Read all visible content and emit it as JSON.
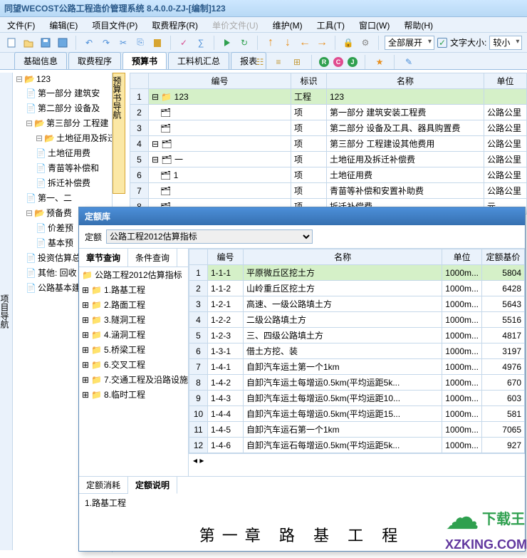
{
  "window": {
    "title": "同望WECOST公路工程造价管理系统 8.4.0.0-ZJ-[编制]123"
  },
  "menu": [
    "文件(F)",
    "编辑(E)",
    "项目文件(P)",
    "取费程序(R)",
    "单价文件(U)",
    "维护(M)",
    "工具(T)",
    "窗口(W)",
    "帮助(H)"
  ],
  "toolbar_combo1": "全部展开",
  "toolbar_label_font": "文字大小:",
  "toolbar_combo2": "较小",
  "tabs": [
    "基础信息",
    "取费程序",
    "预算书",
    "工料机汇总",
    "报表"
  ],
  "active_tab": 2,
  "side_nav_label": "项目导航",
  "inner_nav_label": "预算书导航",
  "tree": [
    {
      "lvl": 0,
      "icon": "folder-open",
      "txt": "123"
    },
    {
      "lvl": 1,
      "icon": "doc",
      "txt": "第一部分 建筑安"
    },
    {
      "lvl": 1,
      "icon": "doc",
      "txt": "第二部分 设备及"
    },
    {
      "lvl": 1,
      "icon": "folder-open",
      "txt": "第三部分 工程建"
    },
    {
      "lvl": 2,
      "icon": "folder-open",
      "txt": "土地征用及拆迁"
    },
    {
      "lvl": 2,
      "icon": "doc",
      "txt": "土地征用费"
    },
    {
      "lvl": 2,
      "icon": "doc",
      "txt": "青苗等补偿和"
    },
    {
      "lvl": 2,
      "icon": "doc",
      "txt": "拆迁补偿费"
    },
    {
      "lvl": 1,
      "icon": "doc",
      "txt": "第一、二"
    },
    {
      "lvl": 1,
      "icon": "folder-open",
      "txt": "预备费"
    },
    {
      "lvl": 2,
      "icon": "doc",
      "txt": "价差预"
    },
    {
      "lvl": 2,
      "icon": "doc",
      "txt": "基本预"
    },
    {
      "lvl": 1,
      "icon": "doc",
      "txt": "投资估算总"
    },
    {
      "lvl": 1,
      "icon": "doc",
      "txt": "其他: 回收"
    },
    {
      "lvl": 1,
      "icon": "doc",
      "txt": "公路基本建"
    }
  ],
  "grid_headers": [
    "编号",
    "标识",
    "名称",
    "单位"
  ],
  "grid_rows": [
    {
      "n": 1,
      "hl": true,
      "code": "123",
      "codeIcon": "minus",
      "mark": "工程",
      "name": "123",
      "unit": ""
    },
    {
      "n": 2,
      "code": "",
      "codeIcon": "card",
      "mark": "项",
      "name": "第一部分 建筑安装工程费",
      "unit": "公路公里"
    },
    {
      "n": 3,
      "code": "",
      "codeIcon": "card",
      "mark": "项",
      "name": "第二部分 设备及工具、器具购置费",
      "unit": "公路公里"
    },
    {
      "n": 4,
      "code": "",
      "codeIcon": "minus-card",
      "mark": "项",
      "name": "第三部分 工程建设其他费用",
      "unit": "公路公里"
    },
    {
      "n": 5,
      "code": "一",
      "codeIcon": "minus-card",
      "mark": "项",
      "name": "土地征用及拆迁补偿费",
      "unit": "公路公里"
    },
    {
      "n": 6,
      "code": "1",
      "codeIcon": "card",
      "mark": "项",
      "name": "土地征用费",
      "unit": "公路公里"
    },
    {
      "n": 7,
      "code": "",
      "codeIcon": "card",
      "mark": "项",
      "name": "青苗等补偿和安置补助费",
      "unit": "公路公里"
    },
    {
      "n": 8,
      "code": "",
      "codeIcon": "card",
      "mark": "项",
      "name": "拆迁补偿费",
      "unit": "元"
    }
  ],
  "dialog": {
    "title": "定额库",
    "label_de": "定额",
    "select_value": "公路工程2012估算指标",
    "left_tabs": [
      "章节查询",
      "条件查询"
    ],
    "tree": [
      {
        "txt": "公路工程2012估算指标"
      },
      {
        "txt": "1.路基工程",
        "exp": true
      },
      {
        "txt": "2.路面工程",
        "exp": true
      },
      {
        "txt": "3.隧洞工程",
        "exp": true
      },
      {
        "txt": "4.涵洞工程",
        "exp": true
      },
      {
        "txt": "5.桥梁工程",
        "exp": true
      },
      {
        "txt": "6.交叉工程",
        "exp": true
      },
      {
        "txt": "7.交通工程及沿路设施",
        "exp": true
      },
      {
        "txt": "8.临时工程",
        "exp": true
      }
    ],
    "grid_headers": [
      "编号",
      "名称",
      "单位",
      "定额基价"
    ],
    "rows": [
      {
        "n": 1,
        "sel": true,
        "code": "1-1-1",
        "name": "平原微丘区挖土方",
        "unit": "1000m...",
        "price": 5804
      },
      {
        "n": 2,
        "code": "1-1-2",
        "name": "山岭重丘区挖土方",
        "unit": "1000m...",
        "price": 6428
      },
      {
        "n": 3,
        "code": "1-2-1",
        "name": "高速、一级公路填土方",
        "unit": "1000m...",
        "price": 5643
      },
      {
        "n": 4,
        "code": "1-2-2",
        "name": "二级公路填土方",
        "unit": "1000m...",
        "price": 5516
      },
      {
        "n": 5,
        "code": "1-2-3",
        "name": "三、四级公路填土方",
        "unit": "1000m...",
        "price": 4817
      },
      {
        "n": 6,
        "code": "1-3-1",
        "name": "借土方挖、装",
        "unit": "1000m...",
        "price": 3197
      },
      {
        "n": 7,
        "code": "1-4-1",
        "name": "自卸汽车运土第一个1km",
        "unit": "1000m...",
        "price": 4976
      },
      {
        "n": 8,
        "code": "1-4-2",
        "name": "自卸汽车运土每增运0.5km(平均运距5k...",
        "unit": "1000m...",
        "price": 670
      },
      {
        "n": 9,
        "code": "1-4-3",
        "name": "自卸汽车运土每增运0.5km(平均运距10...",
        "unit": "1000m...",
        "price": 603
      },
      {
        "n": 10,
        "code": "1-4-4",
        "name": "自卸汽车运土每增运0.5km(平均运距15...",
        "unit": "1000m...",
        "price": 581
      },
      {
        "n": 11,
        "code": "1-4-5",
        "name": "自卸汽车运石第一个1km",
        "unit": "1000m...",
        "price": 7065
      },
      {
        "n": 12,
        "code": "1-4-6",
        "name": "自卸汽车运石每增运0.5km(平均运距5k...",
        "unit": "1000m...",
        "price": 927
      }
    ],
    "bottom_tabs": [
      "定额消耗",
      "定额说明"
    ],
    "doc_line1": "1.路基工程",
    "doc_chapter": "第一章 路 基 工 程"
  },
  "watermark": {
    "brand": "下载王",
    "url": "XZKING.COM"
  }
}
